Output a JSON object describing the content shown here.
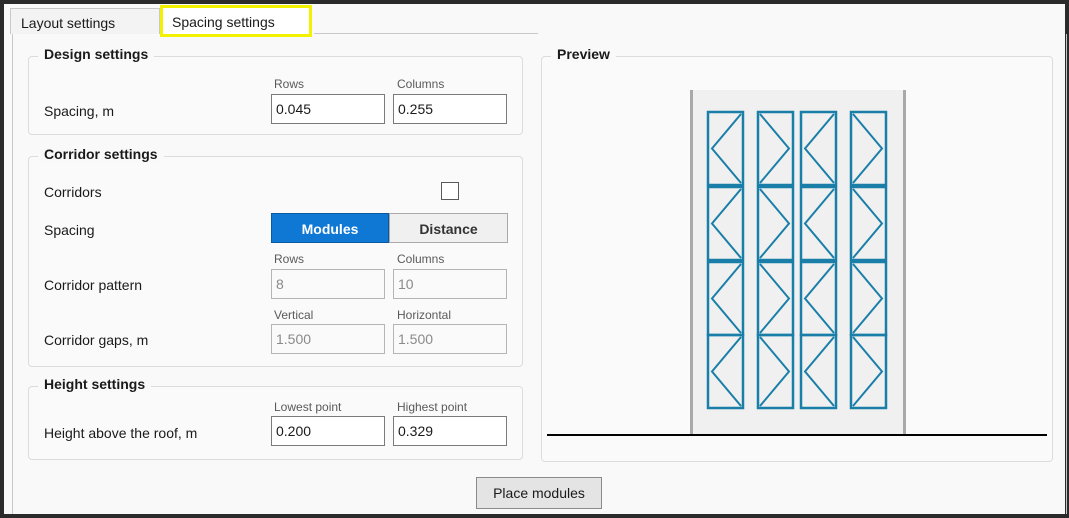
{
  "tabs": {
    "layout": "Layout settings",
    "spacing": "Spacing settings"
  },
  "design": {
    "title": "Design settings",
    "rows_label": "Rows",
    "columns_label": "Columns",
    "spacing_label": "Spacing, m",
    "rows_value": "0.045",
    "columns_value": "0.255"
  },
  "corridor": {
    "title": "Corridor settings",
    "corridors_label": "Corridors",
    "corridors_checked": false,
    "spacing_label": "Spacing",
    "modules_option": "Modules",
    "distance_option": "Distance",
    "selected_option": "Modules",
    "pattern_label": "Corridor pattern",
    "pattern_rows_label": "Rows",
    "pattern_columns_label": "Columns",
    "pattern_rows_value": "8",
    "pattern_columns_value": "10",
    "gaps_label": "Corridor gaps, m",
    "vertical_label": "Vertical",
    "horizontal_label": "Horizontal",
    "vertical_value": "1.500",
    "horizontal_value": "1.500"
  },
  "height": {
    "title": "Height settings",
    "row_label": "Height above the roof, m",
    "lowest_label": "Lowest point",
    "highest_label": "Highest point",
    "lowest_value": "0.200",
    "highest_value": "0.329"
  },
  "preview": {
    "title": "Preview",
    "module_rows": 4,
    "module_columns": 4,
    "colors": {
      "module_stroke": "#1a7fa8",
      "rail": "#a9a9a9",
      "panel_bg": "#f0f0f0",
      "ground": "#000000"
    }
  },
  "actions": {
    "place_modules": "Place modules"
  }
}
